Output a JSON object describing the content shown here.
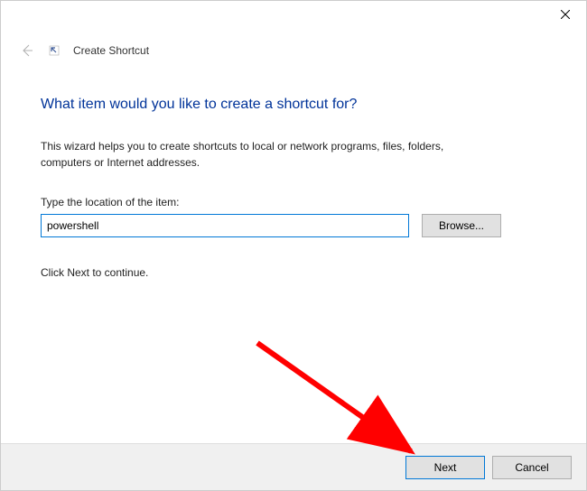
{
  "header": {
    "title": "Create Shortcut"
  },
  "heading": "What item would you like to create a shortcut for?",
  "description": "This wizard helps you to create shortcuts to local or network programs, files, folders, computers or Internet addresses.",
  "input": {
    "label": "Type the location of the item:",
    "value": "powershell"
  },
  "browse_label": "Browse...",
  "continue_text": "Click Next to continue.",
  "footer": {
    "next_label": "Next",
    "cancel_label": "Cancel"
  }
}
